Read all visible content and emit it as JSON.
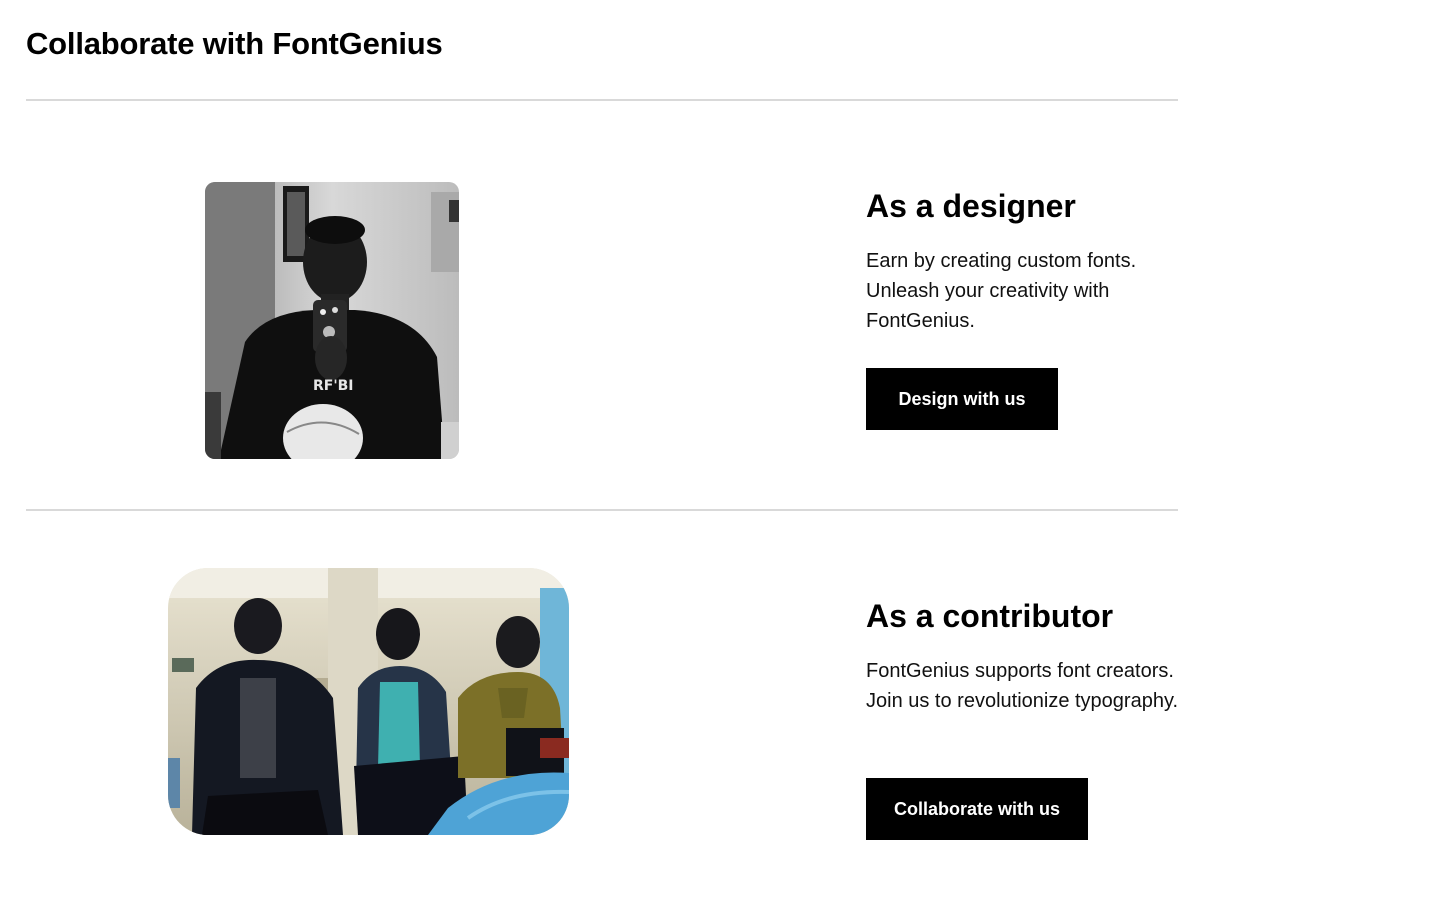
{
  "page": {
    "title": "Collaborate with FontGenius"
  },
  "sections": [
    {
      "heading": "As a designer",
      "description": "Earn by creating custom fonts. Unleash your creativity with FontGenius.",
      "button_label": "Design with us",
      "image_alt": "Designer holding a phone with a rugby ball"
    },
    {
      "heading": "As a contributor",
      "description": "FontGenius supports font creators. Join us to revolutionize typography.",
      "button_label": "Collaborate with us",
      "image_alt": "Three contributors working on laptops"
    }
  ],
  "colors": {
    "button_bg": "#000000",
    "button_text": "#ffffff",
    "divider": "#d9d9d9"
  }
}
